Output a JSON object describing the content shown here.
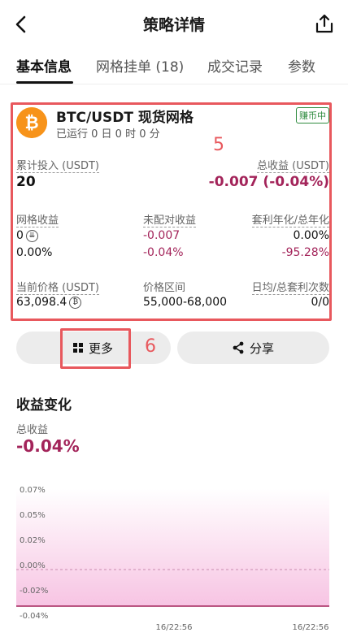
{
  "header": {
    "title": "策略详情"
  },
  "tabs": [
    {
      "label": "基本信息"
    },
    {
      "label": "网格挂单 (18)"
    },
    {
      "label": "成交记录"
    },
    {
      "label": "参数"
    }
  ],
  "card": {
    "pair": "BTC/USDT 现货网格",
    "run_time": "已运行 0 日 0 时 0 分",
    "badge": "赚币中",
    "annotation": "5",
    "total_investment_label": "累计投入 (USDT)",
    "total_investment_value": "20",
    "total_profit_label": "总收益 (USDT)",
    "total_profit_value": "-0.007 (-0.04%)",
    "grid_profit_label": "网格收益",
    "grid_profit_value": "0",
    "grid_profit_pct": "0.00%",
    "unmatched_label": "未配对收益",
    "unmatched_value": "-0.007",
    "unmatched_pct": "-0.04%",
    "apr_label": "套利年化/总年化",
    "apr_value": "0.00%",
    "total_apr_value": "-95.28%",
    "price_label": "当前价格 (USDT)",
    "price_value": "63,098.4",
    "range_label": "价格区间",
    "range_value": "55,000-68,000",
    "arb_count_label": "日均/总套利次数",
    "arb_count_value": "0/0"
  },
  "actions": {
    "more_label": "更多",
    "more_annotation": "6",
    "share_label": "分享"
  },
  "profit_section": {
    "title": "收益变化",
    "sub_label": "总收益",
    "sub_value": "-0.04%"
  },
  "chart_data": {
    "type": "area",
    "y_ticks": [
      "0.07%",
      "0.05%",
      "0.02%",
      "0.00%",
      "-0.02%",
      "-0.04%"
    ],
    "x_ticks": [
      "16/22:56",
      "16/22:56"
    ],
    "ylim": [
      -0.04,
      0.07
    ],
    "series": [
      {
        "values": [
          -0.04,
          -0.04
        ]
      }
    ],
    "colors": {
      "fill": "#f7c4e3",
      "line": "#a3245a"
    }
  }
}
